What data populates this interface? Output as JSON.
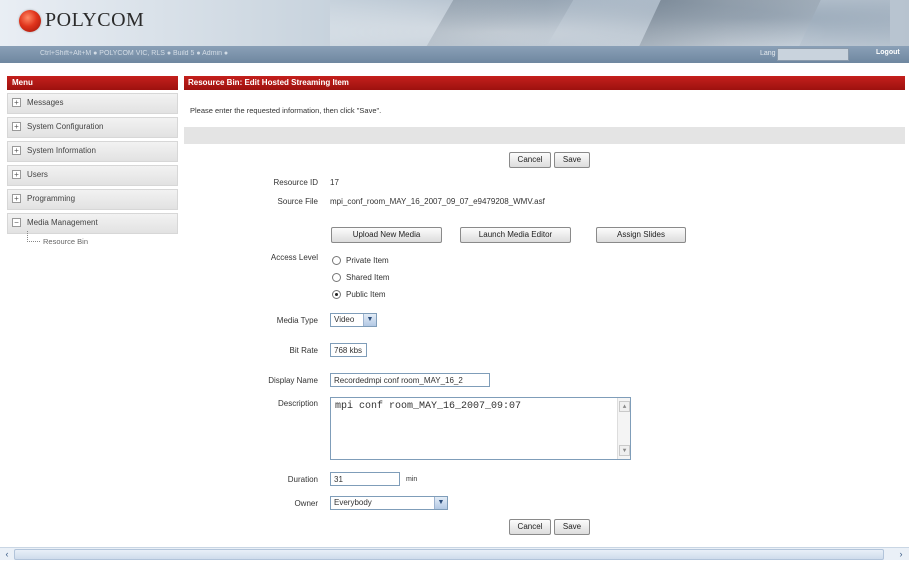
{
  "header": {
    "logo_text": "POLYCOM",
    "info_left": "Ctrl+Shift+Alt+M ● POLYCOM VIC, RLS ● Build 5 ● Admin ●",
    "language_label": "Lang",
    "language_value": "",
    "logout_label": "Logout"
  },
  "menu": {
    "title": "Menu",
    "items": [
      {
        "label": "Messages",
        "toggle": "+"
      },
      {
        "label": "System Configuration",
        "toggle": "+"
      },
      {
        "label": "System Information",
        "toggle": "+"
      },
      {
        "label": "Users",
        "toggle": "+"
      },
      {
        "label": "Programming",
        "toggle": "+"
      },
      {
        "label": "Media Management",
        "toggle": "−"
      }
    ],
    "subitem": "Resource Bin"
  },
  "form": {
    "title": "Resource Bin: Edit Hosted Streaming Item",
    "instructions": "Please enter the requested information, then click \"Save\".",
    "cancel_label": "Cancel",
    "save_label": "Save",
    "resource_id_label": "Resource ID",
    "resource_id_value": "17",
    "source_file_label": "Source File",
    "source_file_value": "mpi_conf_room_MAY_16_2007_09_07_e9479208_WMV.asf",
    "upload_label": "Upload New Media",
    "launch_label": "Launch Media Editor",
    "assign_label": "Assign Slides",
    "access_level_label": "Access Level",
    "access_options": [
      {
        "label": "Private Item",
        "checked": false
      },
      {
        "label": "Shared Item",
        "checked": false
      },
      {
        "label": "Public Item",
        "checked": true
      }
    ],
    "media_type_label": "Media Type",
    "media_type_value": "Video",
    "bit_rate_label": "Bit Rate",
    "bit_rate_value": "768 kbs",
    "display_name_label": "Display Name",
    "display_name_value": "Recordedmpi conf room_MAY_16_2",
    "description_label": "Description",
    "description_value": "mpi conf room_MAY_16_2007_09:07",
    "duration_label": "Duration",
    "duration_value": "31",
    "duration_unit": "min",
    "owner_label": "Owner",
    "owner_value": "Everybody"
  }
}
